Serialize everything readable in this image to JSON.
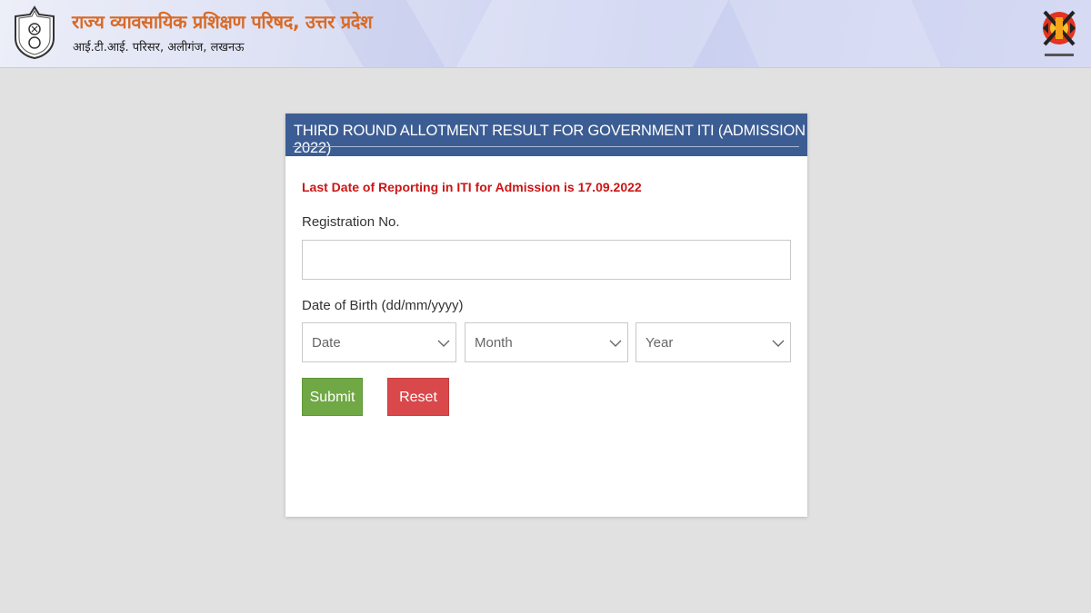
{
  "header": {
    "title": "राज्य व्यावसायिक प्रशिक्षण परिषद, उत्तर प्रदेश",
    "subtitle": "आई.टी.आई. परिसर, अलीगंज, लखनऊ",
    "left_logo_icon": "emblem-icon",
    "right_logo_icon": "skill-logo-icon",
    "title_color": "#d86a26"
  },
  "card": {
    "heading": "THIRD ROUND ALLOTMENT RESULT FOR GOVERNMENT ITI (ADMISSION 2022)",
    "heading_bg": "#3c5d93",
    "notice": "Last Date of Reporting in ITI for Admission is 17.09.2022",
    "notice_color": "#cc1515",
    "registration": {
      "label": "Registration No.",
      "value": "",
      "placeholder": ""
    },
    "dob": {
      "label": "Date of Birth (dd/mm/yyyy)",
      "date_selected": "Date",
      "month_selected": "Month",
      "year_selected": "Year"
    },
    "buttons": {
      "submit_label": "Submit",
      "reset_label": "Reset",
      "submit_color": "#6fa844",
      "reset_color": "#d9494b"
    }
  }
}
